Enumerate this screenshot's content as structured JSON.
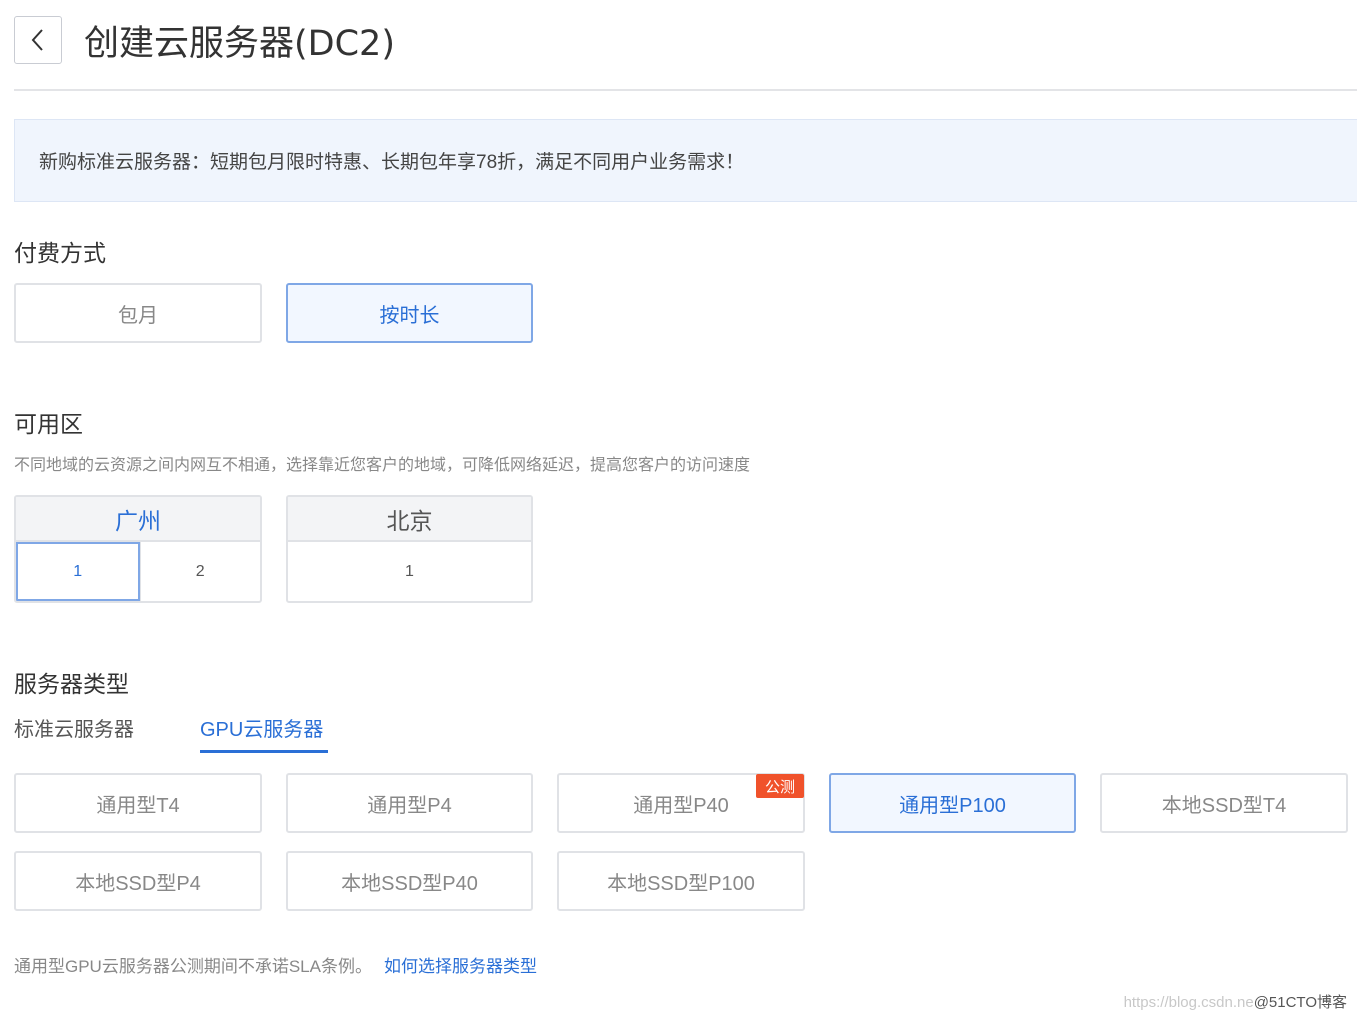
{
  "header": {
    "title": "创建云服务器(DC2)",
    "back_icon": "chevron-left-icon"
  },
  "banner": {
    "text": "新购标准云服务器：短期包月限时特惠、长期包年享78折，满足不同用户业务需求！"
  },
  "billing": {
    "title": "付费方式",
    "options": [
      "包月",
      "按时长"
    ],
    "selected": "按时长"
  },
  "zone_section": {
    "title": "可用区",
    "description": "不同地域的云资源之间内网互不相通，选择靠近您客户的地域，可降低网络延迟，提高您客户的访问速度",
    "regions": [
      {
        "name": "广州",
        "zones": [
          "1",
          "2"
        ]
      },
      {
        "name": "北京",
        "zones": [
          "1"
        ]
      }
    ],
    "selected_region": "广州",
    "selected_zone": "1"
  },
  "server_type": {
    "title": "服务器类型",
    "tabs": [
      "标准云服务器",
      "GPU云服务器"
    ],
    "active_tab": "GPU云服务器",
    "options": [
      "通用型T4",
      "通用型P4",
      "通用型P40",
      "通用型P100",
      "本地SSD型T4",
      "本地SSD型P4",
      "本地SSD型P40",
      "本地SSD型P100"
    ],
    "selected": "通用型P100",
    "badge": {
      "label": "公测",
      "on": "通用型P40"
    },
    "note": "通用型GPU云服务器公测期间不承诺SLA条例。",
    "help_link": "如何选择服务器类型"
  },
  "watermark": {
    "url": "https://blog.csdn.ne",
    "brand": "@51CTO博客"
  },
  "colors": {
    "accent": "#2a6fd6",
    "selected_border": "#7fa7e6",
    "badge": "#f0522b",
    "banner_bg": "#f0f5fd"
  }
}
